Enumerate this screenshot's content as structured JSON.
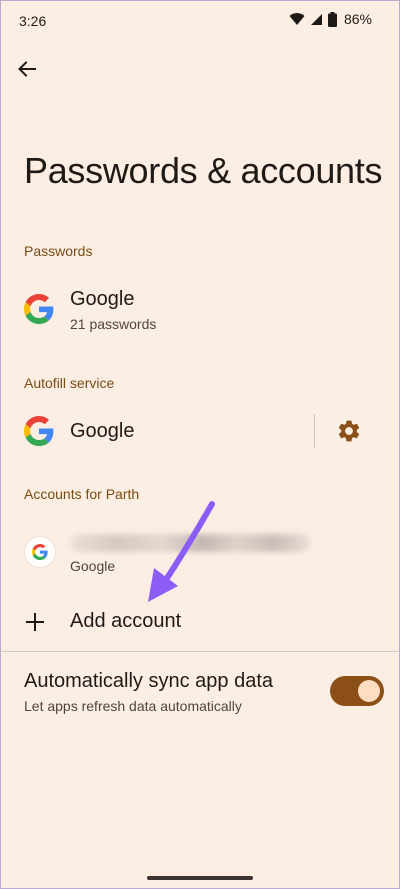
{
  "status_bar": {
    "time": "3:26",
    "battery": "86%",
    "icons": [
      "wifi-icon",
      "signal-icon",
      "battery-icon"
    ]
  },
  "header": {
    "back_icon": "back-arrow-icon",
    "title": "Passwords & accounts"
  },
  "passwords": {
    "section_label": "Passwords",
    "item": {
      "title": "Google",
      "subtitle": "21 passwords",
      "icon": "google-icon"
    }
  },
  "autofill": {
    "section_label": "Autofill service",
    "item": {
      "title": "Google",
      "icon": "google-icon",
      "settings_icon": "gear-icon"
    }
  },
  "accounts": {
    "section_label": "Accounts for Parth",
    "item": {
      "subtitle": "Google",
      "icon": "google-avatar-icon"
    },
    "add_label": "Add account"
  },
  "sync": {
    "title": "Automatically sync app data",
    "subtitle": "Let apps refresh data automatically",
    "enabled": true
  },
  "colors": {
    "background": "#fdeee3",
    "accent": "#8b4f17",
    "section_label": "#7a4b14",
    "annotation_arrow": "#8b5cf6"
  }
}
